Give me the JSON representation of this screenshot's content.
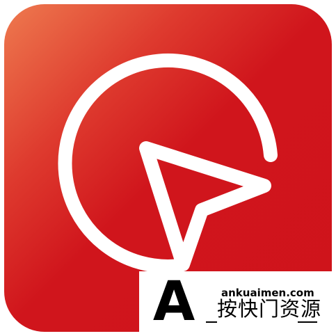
{
  "app_icon": {
    "icon_name": "navigation-compass-icon",
    "colors": {
      "background_dark": "#d0151c",
      "background_light": "#ee7a4f",
      "foreground": "#ffffff"
    }
  },
  "watermark": {
    "letter": "A",
    "domain": "ankuaimen.com",
    "name": "按快门资源"
  }
}
